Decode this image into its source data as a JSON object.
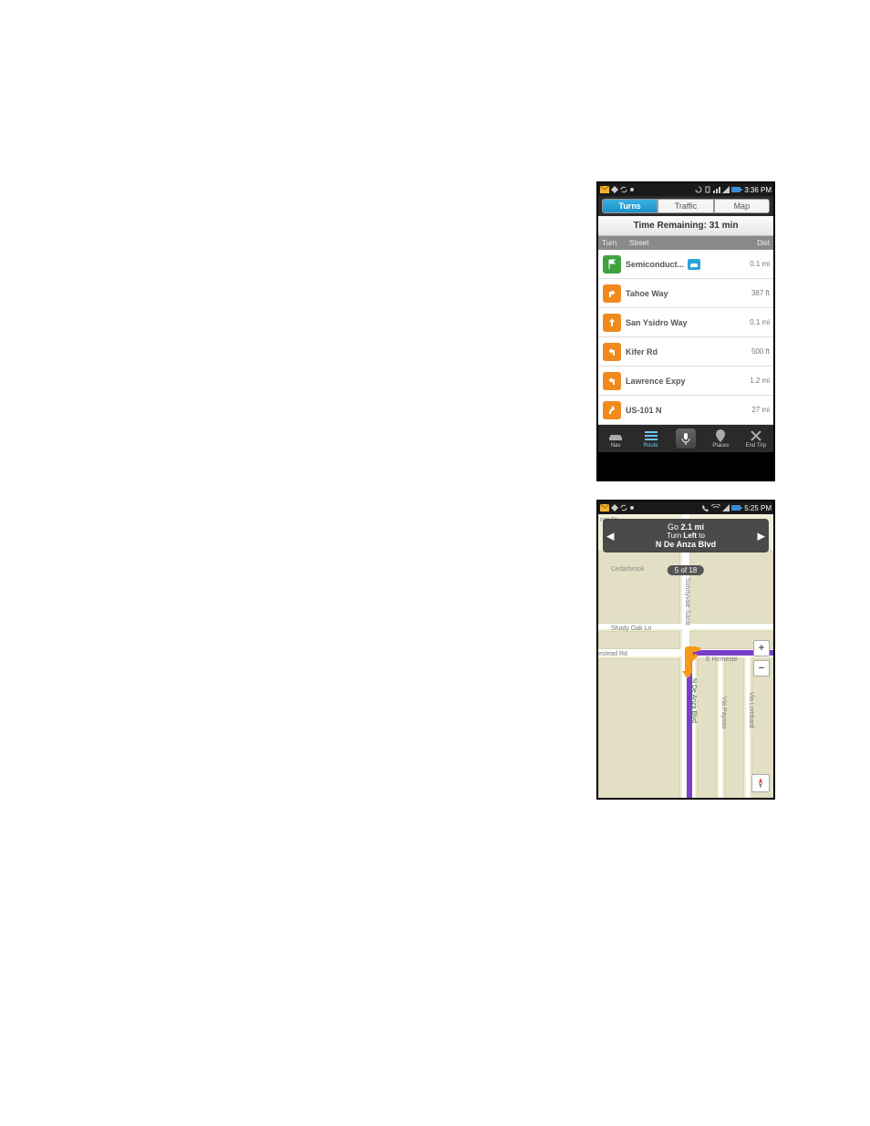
{
  "page": {
    "link_fragment": ""
  },
  "phone1": {
    "status": {
      "time": "3:36 PM"
    },
    "tabs": {
      "turns": "Turns",
      "traffic": "Traffic",
      "map": "Map",
      "active": "turns"
    },
    "time_remaining": "Time Remaining: 31 min",
    "columns": {
      "turn": "Turn",
      "street": "Street",
      "dist": "Dist"
    },
    "rows": [
      {
        "icon": "flag",
        "color": "#3fa33f",
        "street": "Semiconduct...",
        "badge": true,
        "dist": "0.1 mi"
      },
      {
        "icon": "turn-right",
        "color": "#f08a1d",
        "street": "Tahoe Way",
        "badge": false,
        "dist": "387 ft"
      },
      {
        "icon": "straight",
        "color": "#f08a1d",
        "street": "San Ysidro Way",
        "badge": false,
        "dist": "0.1 mi"
      },
      {
        "icon": "turn-left",
        "color": "#f08a1d",
        "street": "Kifer Rd",
        "badge": false,
        "dist": "500 ft"
      },
      {
        "icon": "turn-left",
        "color": "#f08a1d",
        "street": "Lawrence Expy",
        "badge": false,
        "dist": "1.2 mi"
      },
      {
        "icon": "bear-right",
        "color": "#f08a1d",
        "street": "US-101 N",
        "badge": false,
        "dist": "27 mi"
      }
    ],
    "bottom": {
      "nav": "Nav",
      "route": "Route",
      "places": "Places",
      "end": "End Trip"
    }
  },
  "phone2": {
    "status": {
      "time": "5:25 PM"
    },
    "instruction": {
      "line1_pre": "Go ",
      "line1_dist": "2.1 mi",
      "line2_pre": "Turn ",
      "line2_dir": "Left",
      "line2_post": " to",
      "line3": "N De Anza Blvd"
    },
    "step_badge": "5 of 18",
    "labels": {
      "cedarbrook": "Cedarbrook",
      "shadyoak": "Shady Oak Ln",
      "estead": "estead Rd",
      "homeste": "E Homeste",
      "deanza": "N De Anza Blvd",
      "payaso": "Via Payaso",
      "lombard": "Via Lombard",
      "sunnyvale": "Sunnyvale-Sarat",
      "ner": "ner Dr"
    },
    "controls": {
      "zoom_in": "+",
      "zoom_out": "−"
    }
  }
}
